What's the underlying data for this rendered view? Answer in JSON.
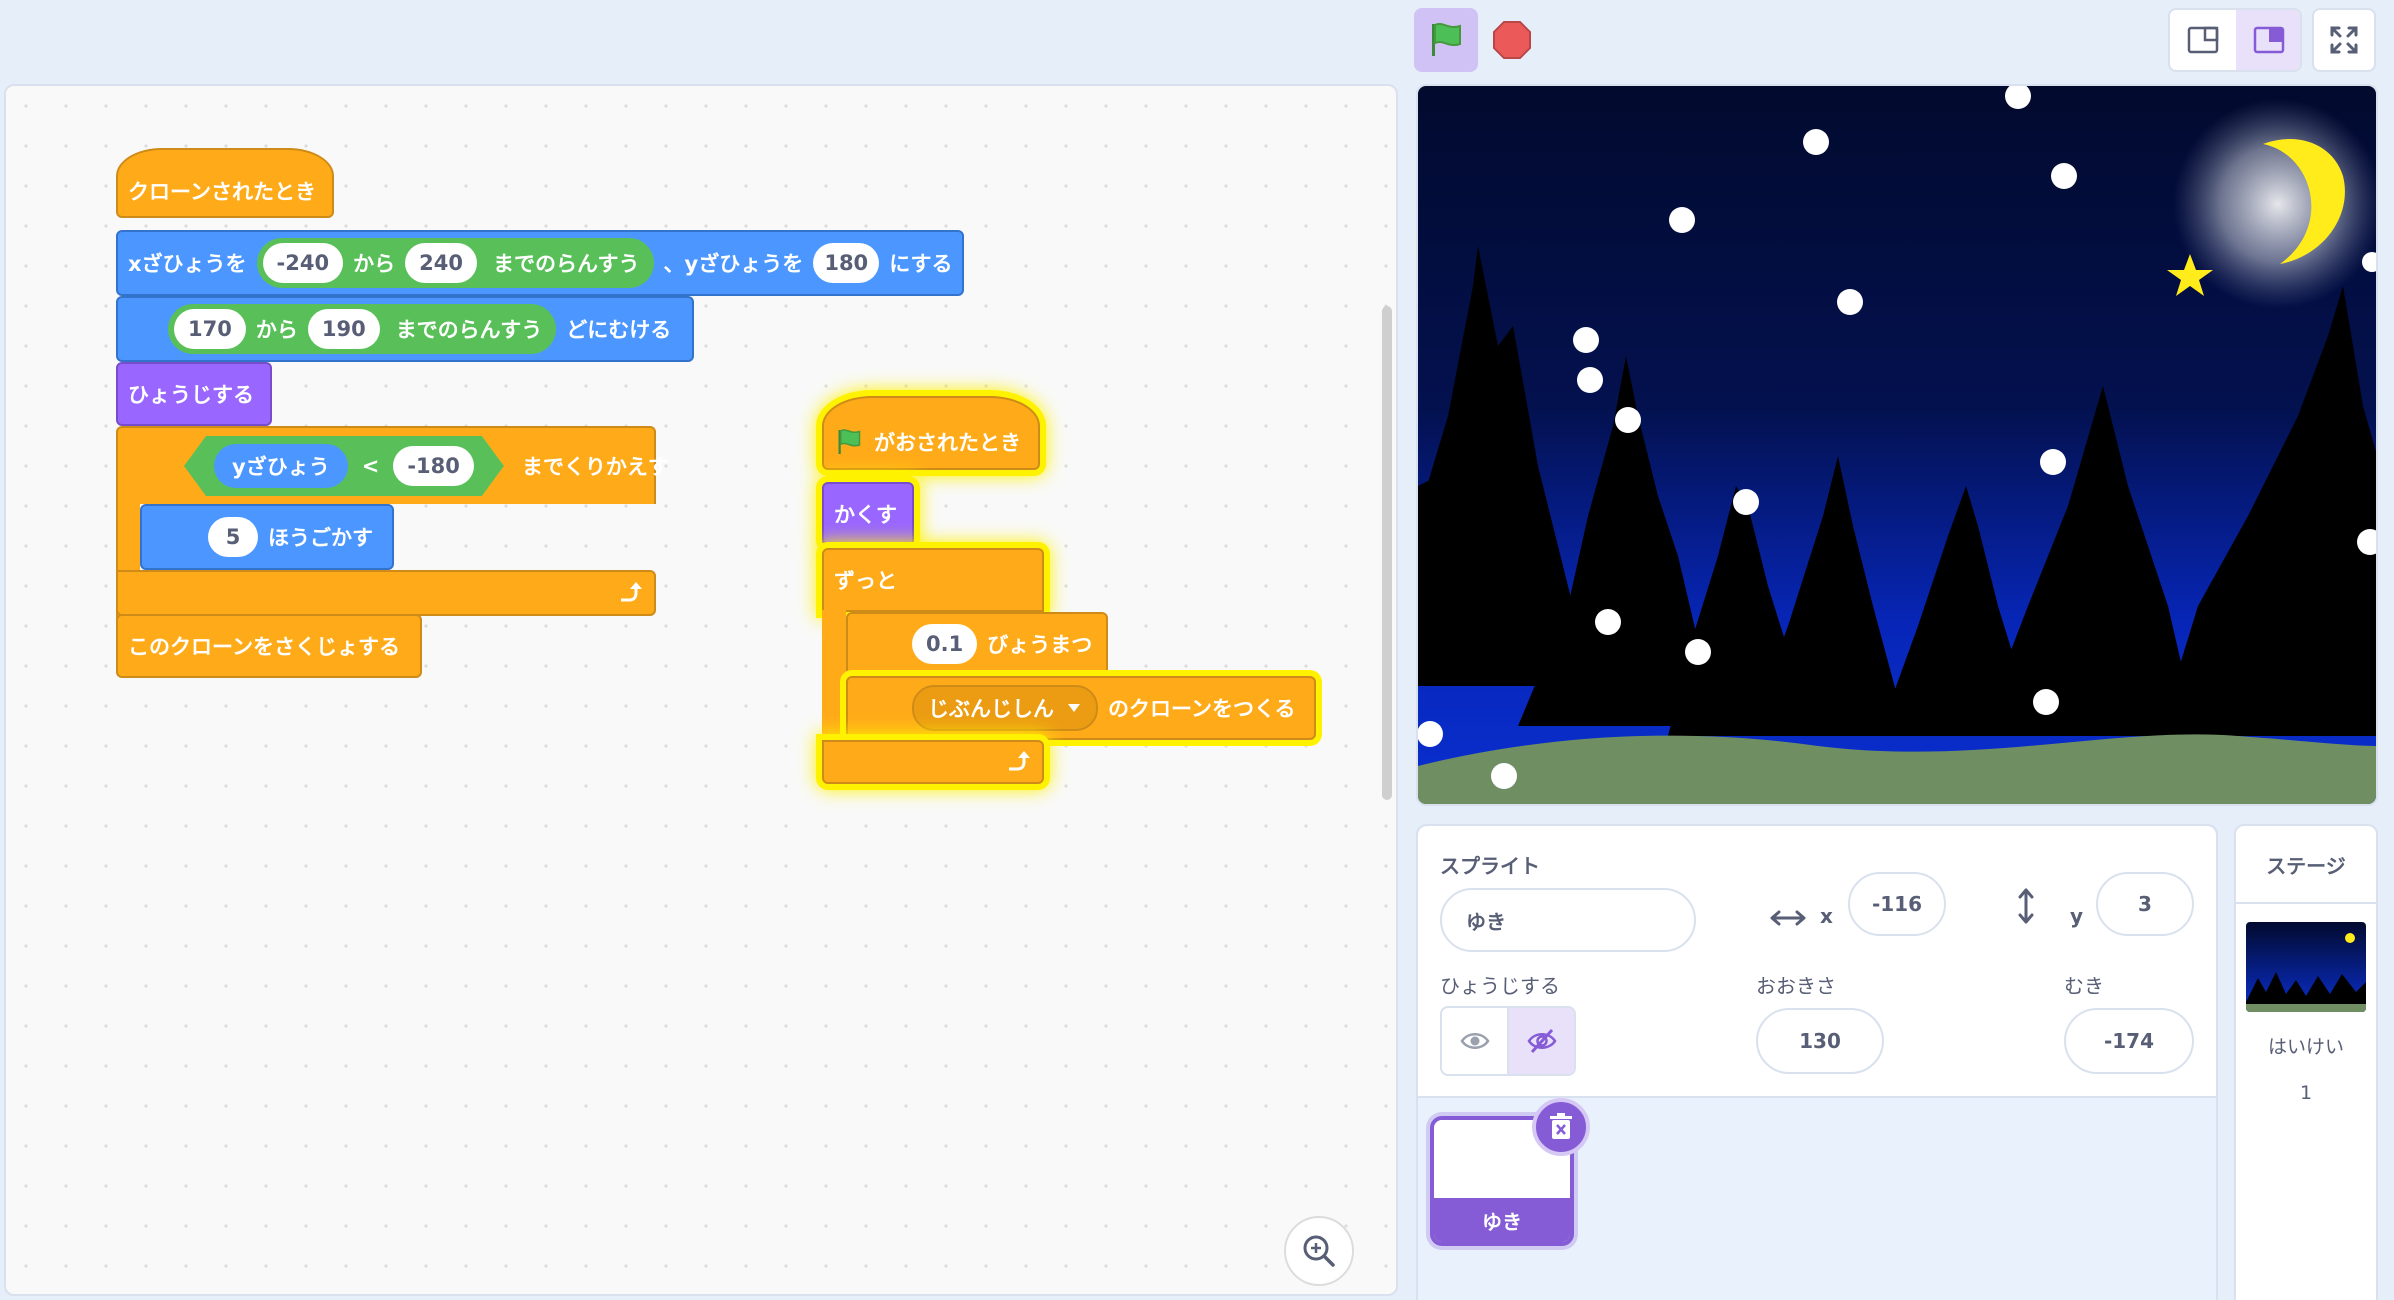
{
  "toolbar": {
    "green_flag": "green-flag-icon",
    "stop": "stop-icon",
    "layout_small": "small-stage-icon",
    "layout_normal": "normal-stage-icon",
    "fullscreen": "fullscreen-icon"
  },
  "script1": {
    "hat": "クローンされたとき",
    "goto": {
      "a": "xざひょうを",
      "x1": "-240",
      "b": "から",
      "x2": "240",
      "c": "までのらんすう",
      "d": "、yざひょうを",
      "y": "180",
      "e": "にする"
    },
    "point": {
      "v1": "170",
      "a": "から",
      "v2": "190",
      "b": "までのらんすう",
      "c": "どにむける"
    },
    "show": "ひょうじする",
    "repeat_until": {
      "left": "yざひょう",
      "op": "<",
      "right": "-180",
      "tail": "までくりかえす"
    },
    "move": {
      "steps": "5",
      "label": "ほうごかす"
    },
    "delete_clone": "このクローンをさくじょする"
  },
  "script2": {
    "hat": "がおされたとき",
    "hide": "かくす",
    "forever": "ずっと",
    "wait": {
      "value": "0.1",
      "label": "びょうまつ"
    },
    "clone": {
      "target": "じぶんじしん",
      "label": "のクローンをつくる"
    }
  },
  "sprite_info": {
    "title": "スプライト",
    "name": "ゆき",
    "x_label": "x",
    "x": "-116",
    "y_label": "y",
    "y": "3",
    "show_label": "ひょうじする",
    "size_label": "おおきさ",
    "size": "130",
    "direction_label": "むき",
    "direction": "-174"
  },
  "sprites": [
    {
      "name": "ゆき"
    }
  ],
  "stage_panel": {
    "title": "ステージ",
    "backdrop_label": "はいけい",
    "backdrop_count": "1"
  },
  "colors": {
    "events": "#ffab19",
    "motion": "#4c97ff",
    "looks": "#9966ff",
    "operators": "#59c059",
    "accent": "#855cd6"
  }
}
